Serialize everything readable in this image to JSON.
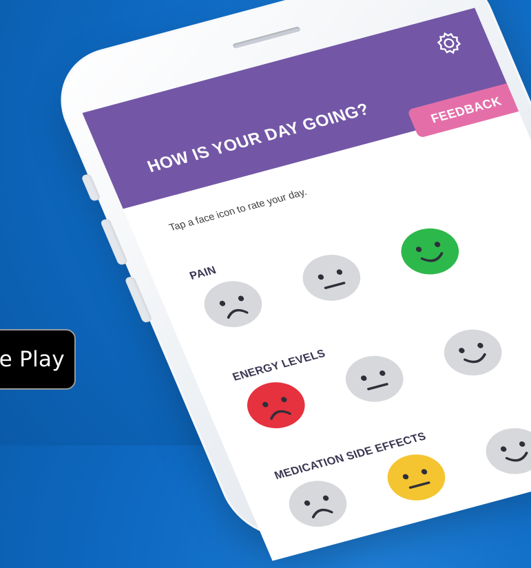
{
  "store_badge": {
    "label": "e Play"
  },
  "app": {
    "header_title": "HOW IS YOUR DAY GOING?",
    "feedback_label": "FEEDBACK",
    "settings_icon": "gear-icon",
    "instruction": "Tap a face icon to rate your day.",
    "sections": [
      {
        "label": "PAIN"
      },
      {
        "label": "ENERGY LEVELS"
      },
      {
        "label": "MEDICATION SIDE EFFECTS"
      }
    ]
  },
  "colors": {
    "background": "#0f6bc4",
    "header": "#7357a6",
    "feedback": "#e46fa8",
    "face_gray": "#d7d8db",
    "face_green": "#2db84b",
    "face_red": "#e5323e",
    "face_yellow": "#f4c531"
  }
}
